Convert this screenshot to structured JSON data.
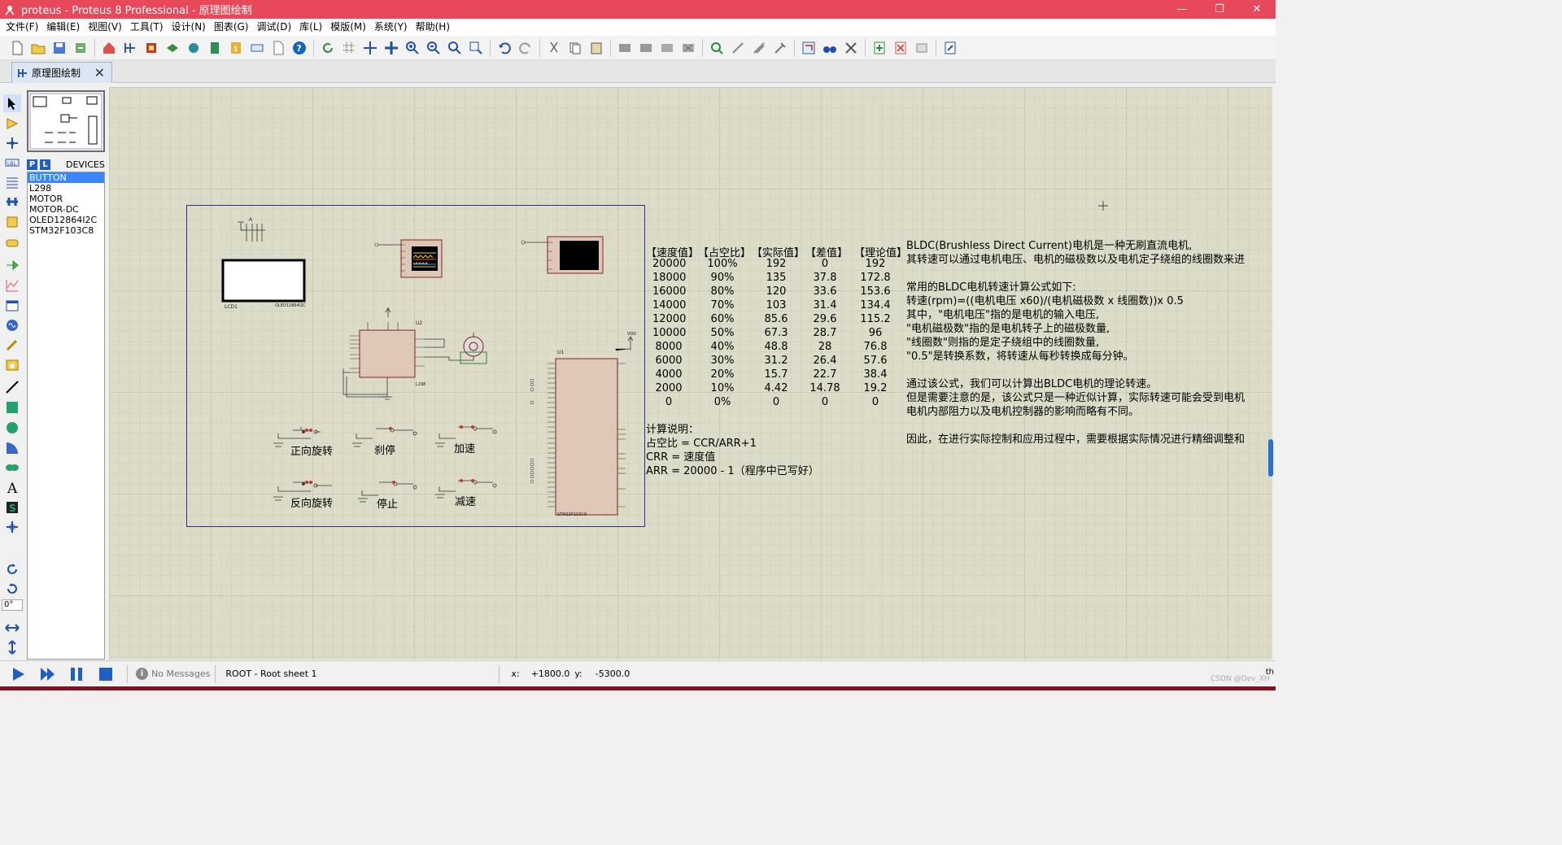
{
  "window": {
    "title": "proteus - Proteus 8 Professional - 原理图绘制",
    "min": "—",
    "restore": "❐",
    "close": "✕"
  },
  "menu": [
    "文件(F)",
    "编辑(E)",
    "视图(V)",
    "工具(T)",
    "设计(N)",
    "图表(G)",
    "调试(D)",
    "库(L)",
    "模版(M)",
    "系统(Y)",
    "帮助(H)"
  ],
  "tab": {
    "label": "原理图绘制"
  },
  "devices": {
    "p_btn": "P",
    "l_btn": "L",
    "label": "DEVICES",
    "items": [
      "BUTTON",
      "L298",
      "MOTOR",
      "MOTOR-DC",
      "OLED12864I2C",
      "STM32F103C8"
    ],
    "selected": "BUTTON"
  },
  "angle": "0°",
  "schematic": {
    "lcd_label": "LCD1",
    "lcd_part": "OLED12864I2C",
    "u2": "U2",
    "u2_part": "L298",
    "u1": "U1",
    "u1_part": "STM32F103C8",
    "vdd": "VDD",
    "buttons": [
      "正向旋转",
      "刹停",
      "加速",
      "反向旋转",
      "停止",
      "减速"
    ]
  },
  "table": {
    "headers": [
      "【速度值】",
      "【占空比】",
      "【实际值】",
      "【差值】",
      "【理论值】"
    ],
    "rows": [
      [
        "20000",
        "100%",
        "192",
        "0",
        "192"
      ],
      [
        "18000",
        "90%",
        "135",
        "37.8",
        "172.8"
      ],
      [
        "16000",
        "80%",
        "120",
        "33.6",
        "153.6"
      ],
      [
        "14000",
        "70%",
        "103",
        "31.4",
        "134.4"
      ],
      [
        "12000",
        "60%",
        "85.6",
        "29.6",
        "115.2"
      ],
      [
        "10000",
        "50%",
        "67.3",
        "28.7",
        "96"
      ],
      [
        "8000",
        "40%",
        "48.8",
        "28",
        "76.8"
      ],
      [
        "6000",
        "30%",
        "31.2",
        "26.4",
        "57.6"
      ],
      [
        "4000",
        "20%",
        "15.7",
        "22.7",
        "38.4"
      ],
      [
        "2000",
        "10%",
        "4.42",
        "14.78",
        "19.2"
      ],
      [
        "0",
        "0%",
        "0",
        "0",
        "0"
      ]
    ]
  },
  "notes": [
    "计算说明：",
    "占空比 = CCR/ARR+1",
    "CRR = 速度值",
    "ARR = 20000 - 1（程序中已写好）"
  ],
  "description": [
    "BLDC(Brushless Direct Current)电机是一种无刷直流电机,",
    "其转速可以通过电机电压、电机的磁极数以及电机定子绕组的线圈数来进",
    "",
    "常用的BLDC电机转速计算公式如下:",
    "转速(rpm)=((电机电压 x60)/(电机磁极数 x 线圈数))x 0.5",
    "其中，\"电机电压\"指的是电机的输入电压,",
    "\"电机磁极数\"指的是电机转子上的磁极数量,",
    "\"线圈数\"则指的是定子绕组中的线圈数量,",
    "\"0.5\"是转换系数，将转速从每秒转换成每分钟。",
    "",
    "通过该公式，我们可以计算出BLDC电机的理论转速。",
    "但是需要注意的是，该公式只是一种近似计算，实际转速可能会受到电机",
    "电机内部阻力以及电机控制器的影响而略有不同。",
    "",
    "因此，在进行实际控制和应用过程中，需要根据实际情况进行精细调整和"
  ],
  "status": {
    "messages": "No Messages",
    "sheet": "ROOT - Root sheet 1",
    "x_label": "x:",
    "x_value": "+1800.0",
    "y_label": "y:",
    "y_value": "-5300.0",
    "watermark": "CSDN @Dev_XH",
    "right_char": "th"
  }
}
